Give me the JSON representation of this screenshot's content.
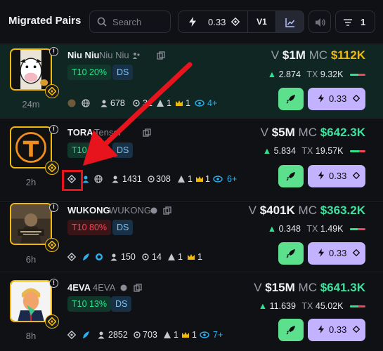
{
  "header": {
    "title": "Migrated Pairs",
    "search_placeholder": "Search",
    "quickbuy_amount": "0.33",
    "version_label": "V1",
    "filter_count": "1"
  },
  "pairs": [
    {
      "symbol": "Niu Niu",
      "name": "Niu Niu",
      "age": "24m",
      "top10": "T10 20%",
      "top10_status": "good",
      "ds": "DS",
      "holders": "678",
      "snipers": "31",
      "insiders": "1",
      "bundlers": "1",
      "watchers_more": "4+",
      "volume": "$1M",
      "market_cap": "$112K",
      "market_cap_color": "#f0b90b",
      "volume_label": "V",
      "market_cap_label": "MC",
      "holder_volume": "2.874",
      "tx_label": "TX",
      "tx": "9.32K",
      "buy_ratio": 0.55,
      "buy_amount": "0.33"
    },
    {
      "symbol": "TORA",
      "name": "Tensor",
      "age": "2h",
      "top10": "T10 20",
      "top10_status": "good",
      "ds": "DS",
      "holders": "1431",
      "snipers": "308",
      "insiders": "1",
      "bundlers": "1",
      "watchers_more": "6+",
      "volume": "$5M",
      "market_cap": "$642.3K",
      "market_cap_color": "#3ee2a0",
      "volume_label": "V",
      "market_cap_label": "MC",
      "holder_volume": "5.834",
      "tx_label": "TX",
      "tx": "19.57K",
      "buy_ratio": 0.6,
      "buy_amount": "0.33"
    },
    {
      "symbol": "WUKONG",
      "name": "WUKONG",
      "age": "6h",
      "top10": "T10 80%",
      "top10_status": "bad",
      "ds": "DS",
      "holders": "150",
      "snipers": "14",
      "insiders": "1",
      "bundlers": "1",
      "watchers_more": "",
      "volume": "$401K",
      "market_cap": "$363.2K",
      "market_cap_color": "#3ee2a0",
      "volume_label": "V",
      "market_cap_label": "MC",
      "holder_volume": "0.348",
      "tx_label": "TX",
      "tx": "1.49K",
      "buy_ratio": 0.5,
      "buy_amount": "0.33"
    },
    {
      "symbol": "4EVA",
      "name": "4EVA",
      "age": "8h",
      "top10": "T10 13%",
      "top10_status": "good",
      "ds": "DS",
      "holders": "2852",
      "snipers": "703",
      "insiders": "1",
      "bundlers": "1",
      "watchers_more": "7+",
      "volume": "$15M",
      "market_cap": "$641.3K",
      "market_cap_color": "#3ee2a0",
      "volume_label": "V",
      "market_cap_label": "MC",
      "holder_volume": "11.639",
      "tx_label": "TX",
      "tx": "45.02K",
      "buy_ratio": 0.55,
      "buy_amount": "0.33"
    }
  ],
  "annotation": {
    "color": "#e8141d"
  },
  "colors": {
    "accent": "#c3b2ff",
    "rocket": "#5de08d",
    "bnb": "#f0b90b",
    "positive": "#2ee28e",
    "negative": "#f4455a"
  }
}
